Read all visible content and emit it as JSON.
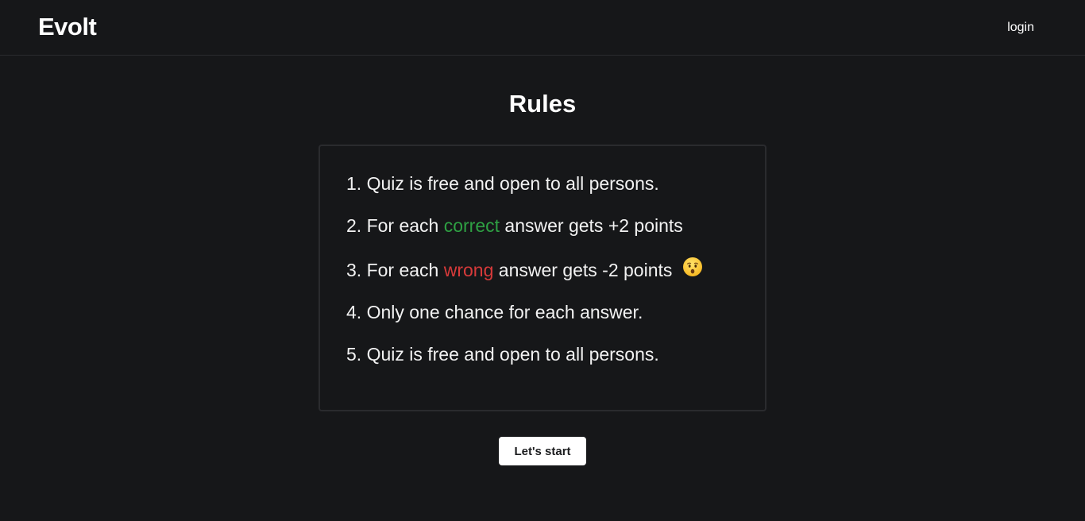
{
  "header": {
    "logo": "Evolt",
    "login_label": "login"
  },
  "main": {
    "title": "Rules",
    "rules": [
      {
        "prefix": "1. Quiz is free and open to all persons.",
        "highlight": "",
        "suffix": ""
      },
      {
        "prefix": "2. For each ",
        "highlight": "correct",
        "suffix": " answer gets +2 points"
      },
      {
        "prefix": "3. For each ",
        "highlight": "wrong",
        "suffix": " answer gets -2 points"
      },
      {
        "prefix": "4. Only one chance for each answer.",
        "highlight": "",
        "suffix": ""
      },
      {
        "prefix": "5. Quiz is free and open to all persons.",
        "highlight": "",
        "suffix": ""
      }
    ],
    "start_label": "Let's start"
  },
  "icons": {
    "rule_3_emoji": "hushed-face-icon"
  },
  "colors": {
    "background": "#161719",
    "correct": "#2ea043",
    "wrong": "#d73a3a",
    "button_bg": "#ffffff"
  }
}
